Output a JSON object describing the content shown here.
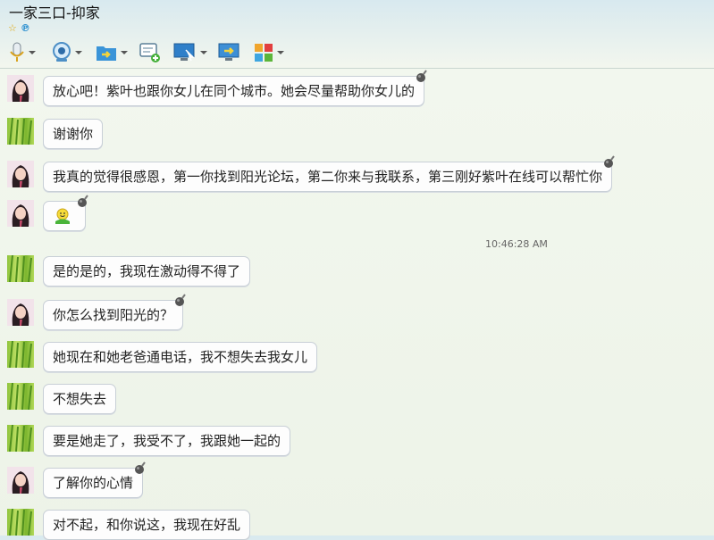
{
  "window": {
    "title": "一家三口-抑家"
  },
  "status_icons": [
    "star-icon",
    "p-icon"
  ],
  "toolbar": {
    "tools": [
      {
        "name": "microphone-button",
        "icon": "microphone-icon"
      },
      {
        "name": "webcam-button",
        "icon": "webcam-icon"
      },
      {
        "name": "send-file-button",
        "icon": "folder-arrow-icon"
      },
      {
        "name": "message-add-button",
        "icon": "message-add-icon"
      },
      {
        "name": "remote-assist-button",
        "icon": "remote-desktop-icon"
      },
      {
        "name": "screen-share-button",
        "icon": "screen-share-icon"
      },
      {
        "name": "apps-button",
        "icon": "apps-grid-icon"
      }
    ]
  },
  "chat": {
    "timestamp": "10:46:28 AM",
    "messages": [
      {
        "sender": "girl",
        "text": "放心吧！紫叶也跟你女儿在同个城市。她会尽量帮助你女儿的"
      },
      {
        "sender": "grass",
        "text": "谢谢你"
      },
      {
        "sender": "girl",
        "text": "我真的觉得很感恩，第一你找到阳光论坛，第二你来与我联系，第三刚好紫叶在线可以帮忙你"
      },
      {
        "sender": "girl",
        "text": "",
        "emoticon": "smiley-emoticon-icon"
      },
      {
        "sender": "grass",
        "text": "是的是的，我现在激动得不得了"
      },
      {
        "sender": "girl",
        "text": "你怎么找到阳光的？"
      },
      {
        "sender": "grass",
        "text": "她现在和她老爸通电话，我不想失去我女儿"
      },
      {
        "sender": "grass",
        "text": "不想失去"
      },
      {
        "sender": "grass",
        "text": "要是她走了，我受不了，我跟她一起的"
      },
      {
        "sender": "girl",
        "text": "了解你的心情"
      },
      {
        "sender": "grass",
        "text": "对不起，和你说这，我现在好乱"
      }
    ]
  }
}
